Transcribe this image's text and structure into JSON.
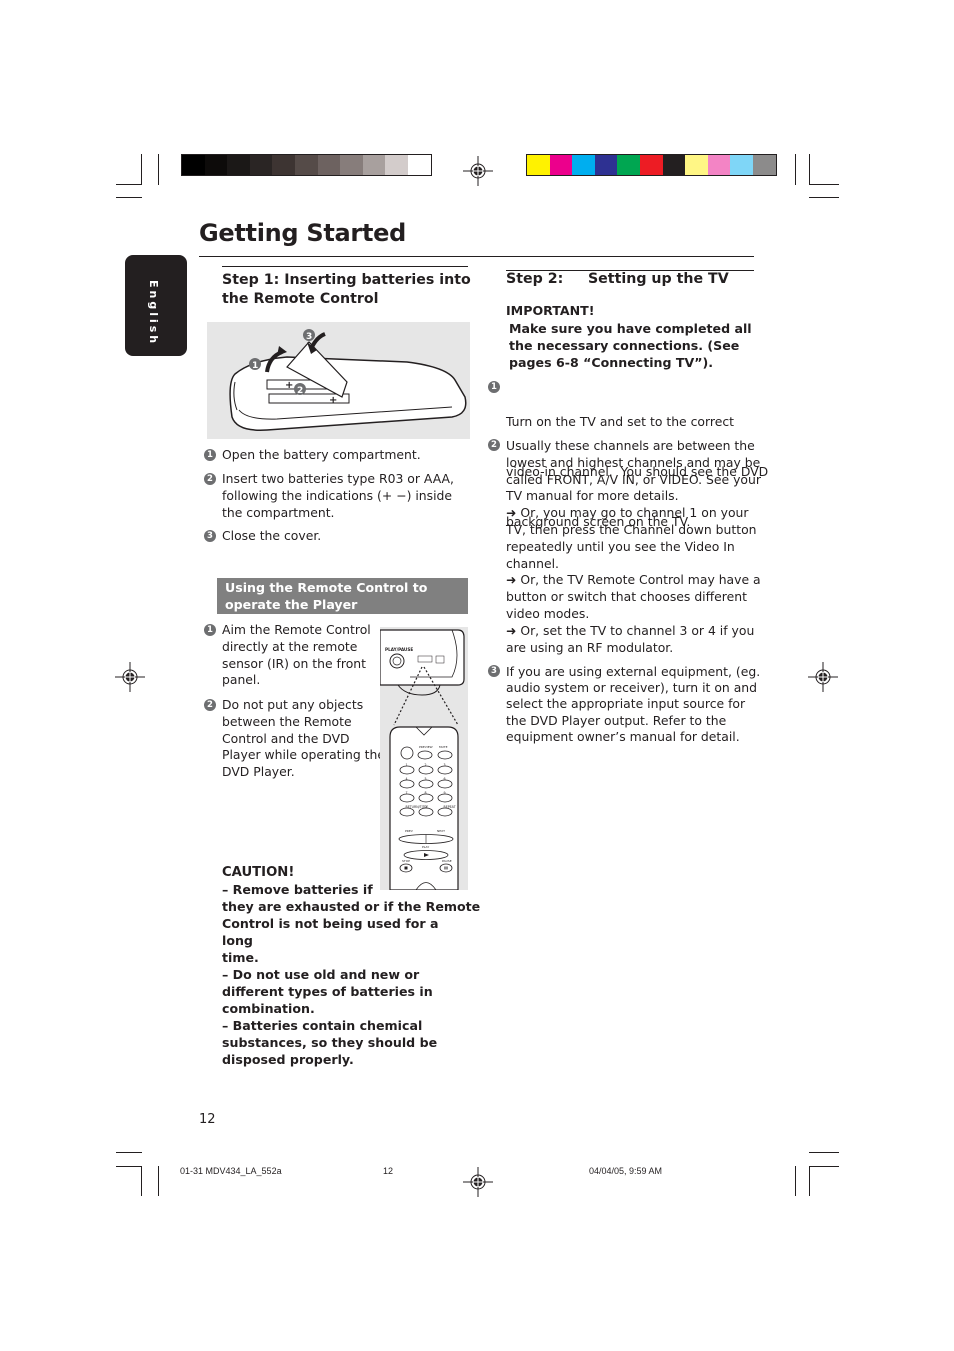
{
  "print_marks": {
    "grayscale_swatches": [
      "#000000",
      "#0d0b0a",
      "#1b1817",
      "#2a2524",
      "#3d3432",
      "#554b48",
      "#6d6260",
      "#877d7b",
      "#a8a09e",
      "#d3cccb",
      "#ffffff"
    ],
    "color_swatches": [
      "#fff200",
      "#ec008c",
      "#00aeef",
      "#2e3192",
      "#00a651",
      "#ed1c24",
      "#231f20",
      "#fff685",
      "#f384c5",
      "#7fd6f7",
      "#8c8b8b"
    ]
  },
  "page": {
    "title": "Getting Started",
    "language_tab": "English",
    "page_number": "12"
  },
  "step1": {
    "heading_line1": "Step 1:  Inserting batteries into",
    "heading_line2": "the Remote Control",
    "illustration": "battery-insertion-diagram",
    "callouts": [
      "1",
      "2",
      "3"
    ],
    "items": [
      {
        "num": "1",
        "text": "Open the battery compartment."
      },
      {
        "num": "2",
        "text_lines": [
          "Insert two batteries type R03 or AAA,",
          "following the indications (+ −) inside",
          "the compartment."
        ]
      },
      {
        "num": "3",
        "text": "Close the cover."
      }
    ]
  },
  "remote_use": {
    "heading_line1": "Using the Remote Control to",
    "heading_line2": "operate the Player",
    "items": [
      {
        "num": "1",
        "text_lines": [
          "Aim the Remote Control",
          "directly at the remote",
          "sensor (IR) on the front",
          "panel."
        ]
      },
      {
        "num": "2",
        "text_lines": [
          "Do not put any objects",
          "between the Remote",
          "Control and the DVD",
          "Player while operating the",
          "DVD Player."
        ]
      }
    ],
    "illustration": {
      "player_button_label": "PLAY/PAUSE",
      "remote_labels": [
        "PREVIEW",
        "MUTE",
        "1",
        "2",
        "3",
        "4",
        "5",
        "6",
        "7",
        "8",
        "9",
        "RETURN/TITLE",
        "0",
        "REPEAT",
        "PREV",
        "NEXT",
        "PLAY",
        "STOP",
        "PAUSE"
      ]
    },
    "caution": {
      "title": "CAUTION!",
      "lines": [
        "–  Remove batteries if",
        "they are exhausted or if the Remote",
        "Control is not being used for a long",
        "time.",
        "–  Do not use old and new or",
        "different types of batteries in",
        "combination.",
        "–  Batteries contain chemical",
        "substances, so they should be",
        "disposed properly."
      ]
    }
  },
  "step2": {
    "heading": "Step 2:     Setting up the TV",
    "important_title": "IMPORTANT!",
    "important_lines": [
      "Make sure you have completed all",
      "the necessary connections. (See",
      "pages 6-8 “Connecting TV”)."
    ],
    "items": [
      {
        "num": "1",
        "text_lines": [
          "Turn on the TV and set to the correct",
          "video-in channel.  You should see the DVD",
          "background screen on the TV."
        ]
      },
      {
        "num": "2",
        "text_lines": [
          "Usually these channels are between the",
          "lowest and highest channels and may be",
          "called FRONT, A/V IN, or VIDEO. See your",
          "TV manual for more details.",
          "➜ Or, you may go to channel 1 on your",
          "TV, then press the Channel down button",
          "repeatedly until you see the Video In",
          "channel.",
          "➜ Or, the TV Remote Control may have a",
          "button or switch that chooses different",
          "video modes.",
          "➜ Or, set the TV to channel 3 or 4 if you",
          "are using an RF modulator."
        ]
      },
      {
        "num": "3",
        "text_lines": [
          "If you are using external equipment, (eg.",
          "audio system or receiver), turn it on and",
          "select the appropriate input source for",
          "the DVD Player output. Refer to the",
          "equipment owner’s manual for detail."
        ]
      }
    ]
  },
  "slug": {
    "file": "01-31 MDV434_LA_552a",
    "page": "12",
    "datetime": "04/04/05, 9:59 AM"
  }
}
